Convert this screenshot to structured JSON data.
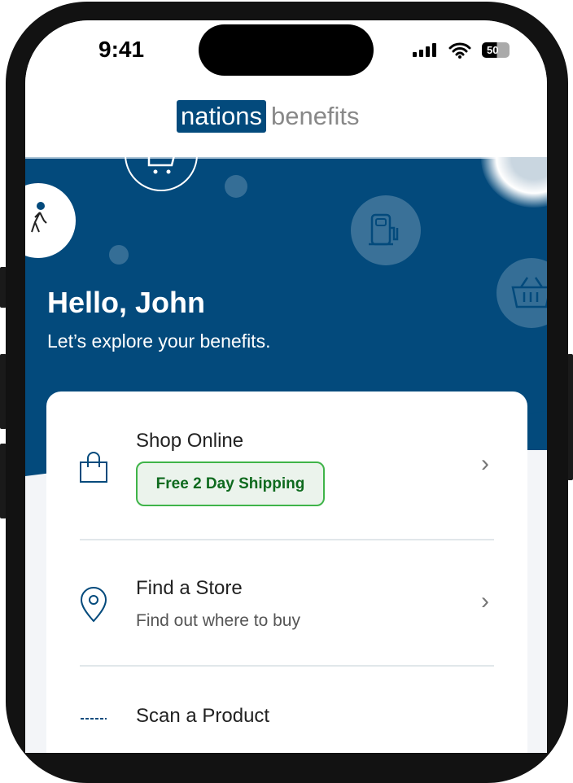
{
  "status_bar": {
    "time": "9:41",
    "battery": "50"
  },
  "logo": {
    "part1": "nations",
    "part2": "benefits"
  },
  "hero": {
    "greeting": "Hello, John",
    "subtitle": "Let’s explore your benefits."
  },
  "menu": [
    {
      "title": "Shop Online",
      "badge": "Free 2 Day Shipping",
      "icon": "shopping-bag-icon"
    },
    {
      "title": "Find a Store",
      "description": "Find out where to buy",
      "icon": "map-pin-icon"
    },
    {
      "title": "Scan a Product",
      "icon": "barcode-icon"
    }
  ],
  "colors": {
    "brand": "#034a7c",
    "badge_green": "#3fb449"
  }
}
